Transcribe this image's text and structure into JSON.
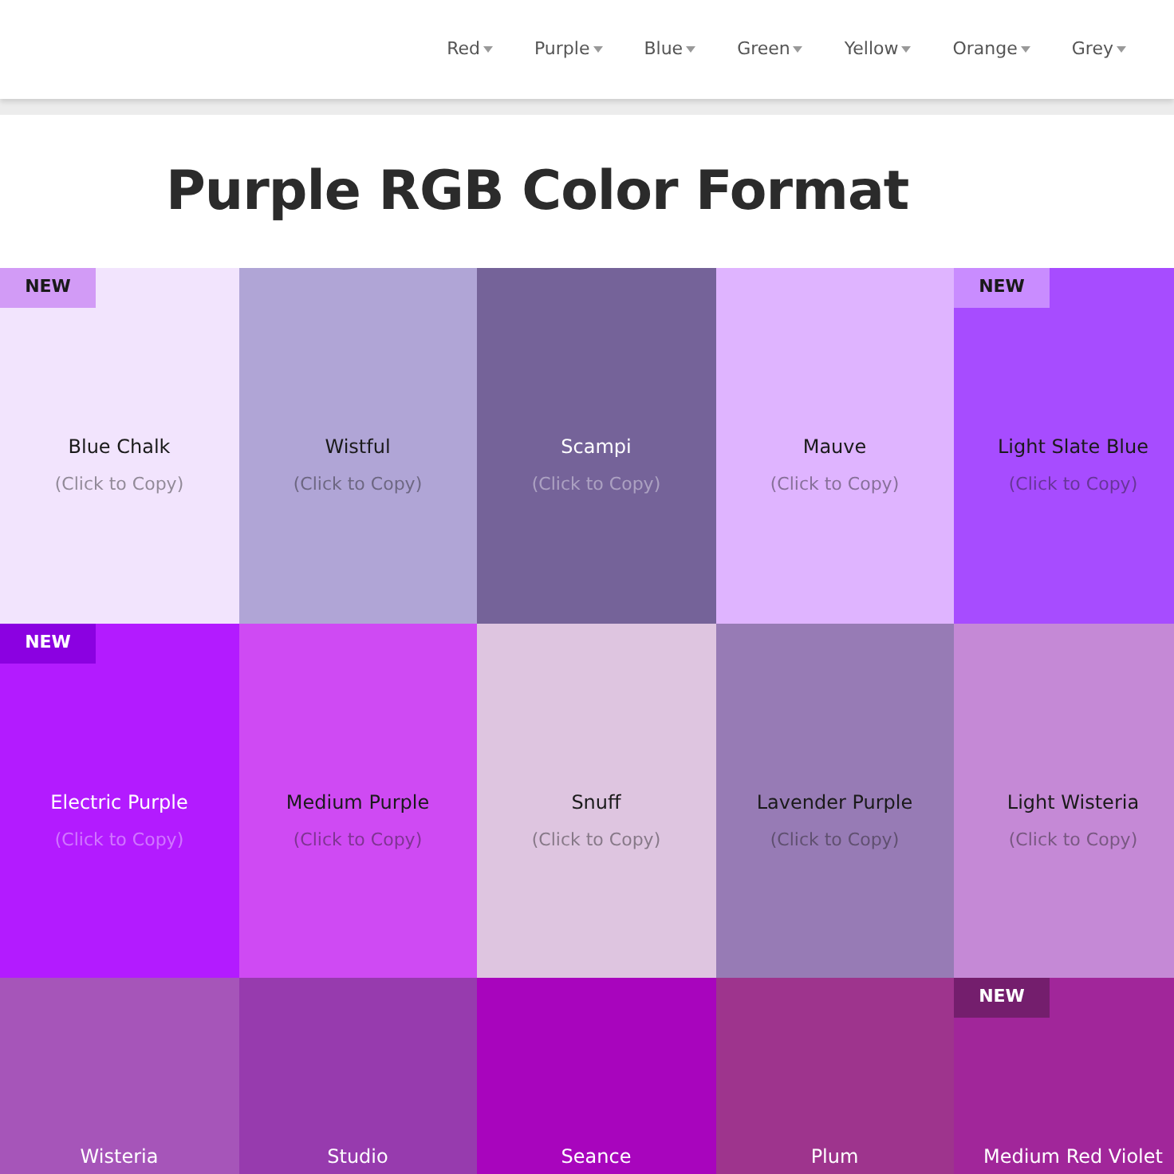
{
  "nav": {
    "items": [
      {
        "label": "Red"
      },
      {
        "label": "Purple"
      },
      {
        "label": "Blue"
      },
      {
        "label": "Green"
      },
      {
        "label": "Yellow"
      },
      {
        "label": "Orange"
      },
      {
        "label": "Grey"
      }
    ]
  },
  "title": "Purple RGB Color Format",
  "tiles": [
    {
      "name": "Blue Chalk",
      "hint": "(Click to Copy)",
      "color": "#f2e4fd",
      "kind": "pale",
      "badge": {
        "label": "NEW",
        "color": "#d29bf6"
      }
    },
    {
      "name": "Wistful",
      "hint": "(Click to Copy)",
      "color": "#b0a5d6",
      "kind": "pale"
    },
    {
      "name": "Scampi",
      "hint": "(Click to Copy)",
      "color": "#756399",
      "kind": "deep"
    },
    {
      "name": "Mauve",
      "hint": "(Click to Copy)",
      "color": "#dfb4ff",
      "kind": "pale"
    },
    {
      "name": "Light Slate Blue",
      "hint": "(Click to Copy)",
      "color": "#a74cff",
      "kind": "pale",
      "badge": {
        "label": "NEW",
        "color": "#c98cff"
      }
    },
    {
      "name": "Electric Purple",
      "hint": "(Click to Copy)",
      "color": "#b31bff",
      "kind": "deep",
      "badge": {
        "label": "NEW",
        "color": "#8b01e1"
      }
    },
    {
      "name": "Medium Purple",
      "hint": "(Click to Copy)",
      "color": "#cf4af3",
      "kind": "pale"
    },
    {
      "name": "Snuff",
      "hint": "(Click to Copy)",
      "color": "#dec5e0",
      "kind": "pale"
    },
    {
      "name": "Lavender Purple",
      "hint": "(Click to Copy)",
      "color": "#977bb5",
      "kind": "pale"
    },
    {
      "name": "Light Wisteria",
      "hint": "(Click to Copy)",
      "color": "#c589d6",
      "kind": "pale"
    },
    {
      "name": "Wisteria",
      "color": "#a655b9",
      "kind": "deep"
    },
    {
      "name": "Studio",
      "color": "#973bae",
      "kind": "deep"
    },
    {
      "name": "Seance",
      "color": "#a805bd",
      "kind": "deep"
    },
    {
      "name": "Plum",
      "color": "#9e348d",
      "kind": "deep"
    },
    {
      "name": "Medium Red Violet",
      "color": "#a1269a",
      "kind": "deep",
      "badge": {
        "label": "NEW",
        "color": "#741e6d"
      }
    }
  ]
}
